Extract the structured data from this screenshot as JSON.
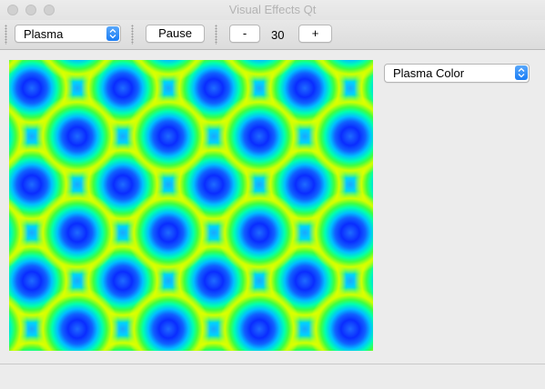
{
  "window": {
    "title": "Visual Effects Qt"
  },
  "toolbar": {
    "effect_select": "Plasma",
    "pause_label": "Pause",
    "minus_label": "-",
    "count_value": "30",
    "plus_label": "+"
  },
  "side_panel": {
    "color_select": "Plasma Color"
  },
  "colors": {
    "accent": "#1a7cf4"
  },
  "icons": {
    "combo_arrow": "up-down-chevron-icon",
    "window_buttons": "traffic-light-icon"
  }
}
